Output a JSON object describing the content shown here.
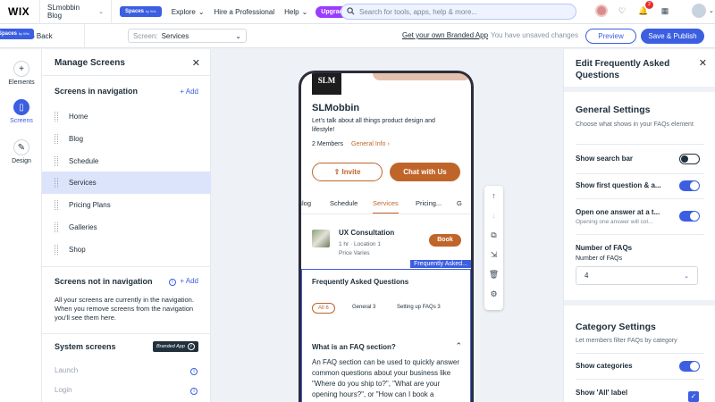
{
  "topbar": {
    "logo": "WIX",
    "site_name": "SLmobbin Blog",
    "spaces_label": "Spaces",
    "spaces_by": "by Wix",
    "menu": [
      {
        "label": "Explore",
        "chevron": true
      },
      {
        "label": "Hire a Professional",
        "chevron": false
      },
      {
        "label": "Help",
        "chevron": true
      }
    ],
    "upgrade_label": "Upgrade",
    "search_placeholder": "Search for tools, apps, help & more...",
    "notification_count": "2"
  },
  "secondbar": {
    "back_label": "Go Back",
    "screen_label": "Screen:",
    "screen_value": "Services",
    "branded_app_link": "Get your own Branded App",
    "unsaved_text": "You have unsaved changes",
    "preview_label": "Preview",
    "publish_label": "Save & Publish"
  },
  "rail": {
    "items": [
      {
        "label": "Elements",
        "icon": "plus-icon"
      },
      {
        "label": "Screens",
        "icon": "page-icon"
      },
      {
        "label": "Design",
        "icon": "brush-icon"
      }
    ]
  },
  "manage": {
    "title": "Manage Screens",
    "in_nav_title": "Screens in navigation",
    "add_label": "Add",
    "nav_items": [
      "Home",
      "Blog",
      "Schedule",
      "Services",
      "Pricing Plans",
      "Galleries",
      "Shop"
    ],
    "not_in_nav_title": "Screens not in navigation",
    "not_in_nav_note": "All your screens are currently in the navigation. When you remove screens from the navigation you'll see them here.",
    "system_title": "System screens",
    "branded_badge": "Branded App",
    "system_items": [
      "Launch",
      "Login"
    ]
  },
  "phone": {
    "logo_text": "SLM",
    "title": "SLMobbin",
    "description": "Let's talk about all things product design and lifestyle!",
    "members": "2 Members",
    "general_info": "General Info",
    "invite_label": "Invite",
    "chat_label": "Chat with Us",
    "tabs": [
      "Blog",
      "Schedule",
      "Services",
      "Pricing...",
      "G"
    ],
    "service": {
      "title": "UX Consultation",
      "meta": "1 hr · Location 1",
      "price": "Price Varies",
      "book_label": "Book"
    },
    "faq": {
      "tag": "Frequently Asked...",
      "title": "Frequently Asked Questions",
      "categories": [
        "All 6",
        "General 3",
        "Setting up FAQs 3"
      ],
      "question": "What is an FAQ section?",
      "answer": "An FAQ section can be used to quickly answer common questions about your business like \"Where do you ship to?\", \"What are your opening hours?\", or \"How can I book a"
    }
  },
  "right_panel": {
    "title": "Edit Frequently Asked Questions",
    "general_title": "General Settings",
    "general_sub": "Choose what shows in your FAQs element",
    "rows": [
      {
        "label": "Show search bar",
        "sub": "",
        "on": false
      },
      {
        "label": "Show first question & a...",
        "sub": "",
        "on": true
      },
      {
        "label": "Open one answer at a t...",
        "sub": "Opening one answer will col...",
        "on": true
      }
    ],
    "number_title": "Number of FAQs",
    "number_label": "Number of FAQs",
    "number_value": "4",
    "category_title": "Category Settings",
    "category_sub": "Let members filter FAQs by category",
    "show_categories": "Show categories",
    "show_all_label": "Show 'All' label"
  }
}
